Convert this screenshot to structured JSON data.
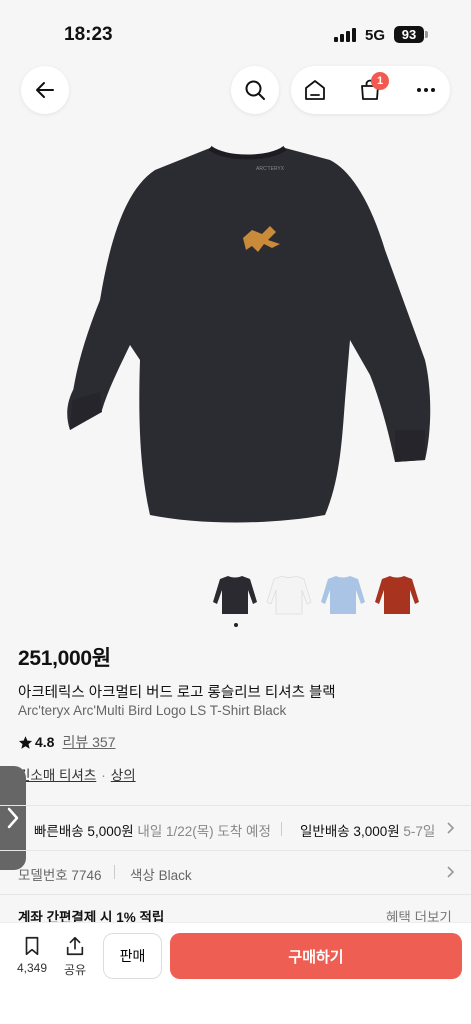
{
  "status_bar": {
    "time": "18:23",
    "network": "5G",
    "battery": "93"
  },
  "nav": {
    "cart_count": "1"
  },
  "product": {
    "price": "251,000원",
    "title_ko": "아크테릭스 아크멀티 버드 로고 롱슬리브 티셔츠 블랙",
    "title_en": "Arc'teryx Arc'Multi Bird Logo LS T-Shirt Black",
    "rating": "4.8",
    "review_label": "리뷰 357",
    "category_1": "긴소매 티셔츠",
    "category_2": "상의",
    "variant_colors": [
      "#2a2a30",
      "#f4f4f4",
      "#a9c4e4",
      "#a8341f"
    ]
  },
  "shipping": {
    "fast_label": "빠른배송 5,000원",
    "fast_eta": "내일 1/22(목) 도착 예정",
    "normal_label": "일반배송 3,000원",
    "normal_eta": "5-7일"
  },
  "details": {
    "model": "모델번호 7746",
    "color": "색상 Black"
  },
  "benefit": {
    "label": "계좌 간편결제 시 1% 적립",
    "more": "혜택 더보기"
  },
  "bottom": {
    "save_count": "4,349",
    "share_label": "공유",
    "sell_label": "판매",
    "buy_label": "구매하기"
  },
  "colors": {
    "accent": "#ee5e52",
    "badge": "#f35a4f"
  }
}
